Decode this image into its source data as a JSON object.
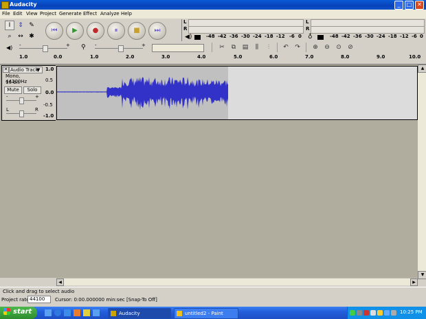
{
  "window": {
    "title": "Audacity",
    "min": "_",
    "max": "□",
    "close": "✕"
  },
  "menu": [
    "File",
    "Edit",
    "View",
    "Project",
    "Generate",
    "Effect",
    "Analyze",
    "Help"
  ],
  "tools": {
    "select": "I",
    "envelope": "⇕",
    "draw": "✎",
    "zoom": "⌕",
    "timeshift": "↔",
    "multi": "✱"
  },
  "transport": {
    "rewind": "⏮",
    "play": "▶",
    "record": "●",
    "pause": "⏸",
    "stop": "■",
    "ffwd": "⏭"
  },
  "meters": {
    "play_L": "L",
    "play_R": "R",
    "rec_L": "L",
    "rec_R": "R",
    "scale": [
      "-48",
      "-42",
      "-36",
      "-30",
      "-24",
      "-18",
      "-12",
      "-6",
      "0"
    ]
  },
  "mixer": {
    "volume_icon": "🔊",
    "mic_icon": "🎤",
    "minus": "-",
    "plus": "+"
  },
  "ruler": {
    "labels": [
      "1.0",
      "0.0",
      "1.0",
      "2.0",
      "3.0",
      "4.0",
      "5.0",
      "6.0",
      "7.0",
      "8.0",
      "9.0",
      "10.0"
    ]
  },
  "track": {
    "name": "Audio Track",
    "format": "Mono, 44100Hz",
    "bits": "16-bit",
    "mute": "Mute",
    "solo": "Solo",
    "gain_minus": "-",
    "gain_plus": "+",
    "pan_left": "L",
    "pan_right": "R",
    "scale": [
      "1.0",
      "0.5",
      "0.0",
      "-0.5",
      "-1.0"
    ]
  },
  "status": {
    "hint": "Click and drag to select audio",
    "project_rate_label": "Project rate:",
    "project_rate": "44100",
    "cursor": "Cursor: 0:00.000000 min:sec  [Snap-To Off]"
  },
  "taskbar": {
    "start": "start",
    "tasks": [
      "Audacity",
      "untitled2 - Paint"
    ],
    "clock": "10:25 PM"
  },
  "colors": {
    "waveform": "#3232c8",
    "title_bar": "#0842b8",
    "taskbar": "#245edb"
  }
}
